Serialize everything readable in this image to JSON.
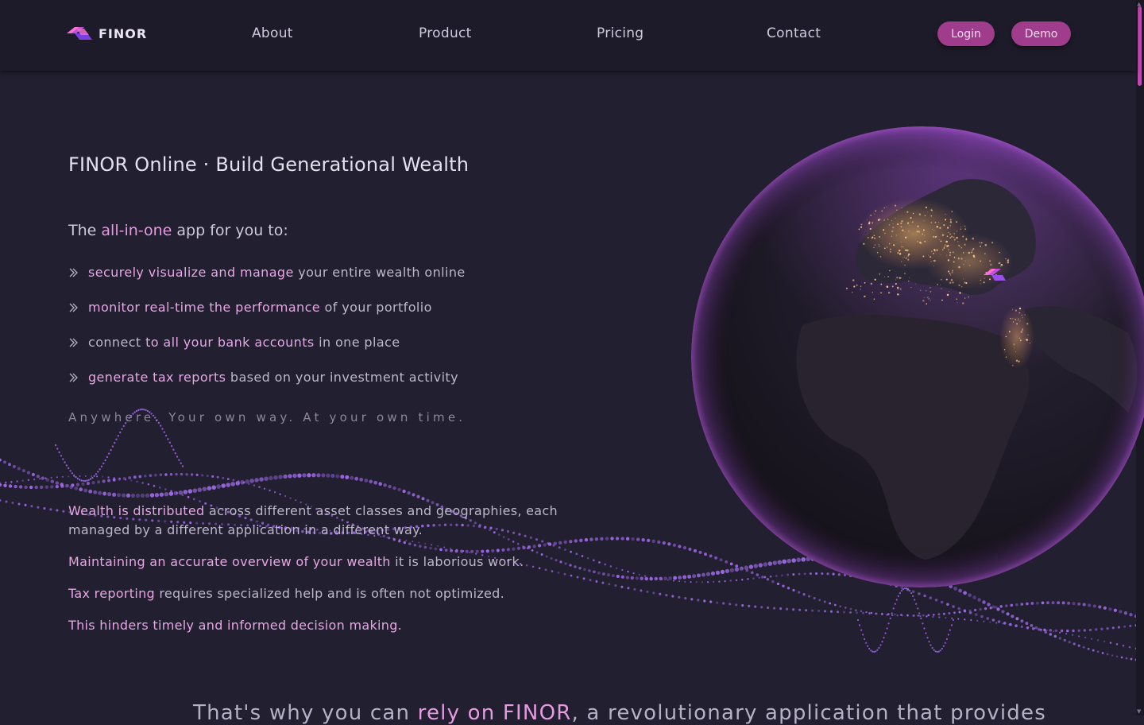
{
  "brand": {
    "name": "FINOR",
    "accent": "#e49be0",
    "button_color": "#a03c8c"
  },
  "nav": {
    "items": [
      "About",
      "Product",
      "Pricing",
      "Contact"
    ],
    "login_label": "Login",
    "demo_label": "Demo"
  },
  "hero": {
    "title": "FINOR Online · Build Generational Wealth",
    "intro": {
      "before": "The ",
      "highlight": "all-in-one",
      "after": " app for you to:"
    },
    "features": [
      {
        "pre": "",
        "hl": "securely visualize and manage",
        "post": " your entire wealth online"
      },
      {
        "pre": "",
        "hl": "monitor real-time the performance",
        "post": " of your portfolio"
      },
      {
        "pre": "connect ",
        "hl": "to all your bank accounts",
        "post": " in one place"
      },
      {
        "pre": "",
        "hl": "generate tax reports",
        "post": " based on your investment activity"
      }
    ],
    "tagline": "Anywhere. Your own way. At your own time."
  },
  "problems": [
    {
      "hl": "Wealth is distributed",
      "rest": " across different asset classes and geographies, each managed by a different application in a different way."
    },
    {
      "hl": "Maintaining an accurate overview of your wealth",
      "rest": " it is laborious work."
    },
    {
      "hl": "Tax reporting",
      "rest": " requires specialized help and is often not optimized."
    },
    {
      "hl": "This hinders timely and informed decision making.",
      "rest": ""
    }
  ],
  "bottom": {
    "before": "That's why you can ",
    "highlight": "rely on FINOR",
    "after": ", a revolutionary application that provides"
  },
  "icons": [
    "finor-logo-icon",
    "chevron-right-icon",
    "globe-image",
    "particle-wave-decoration"
  ]
}
